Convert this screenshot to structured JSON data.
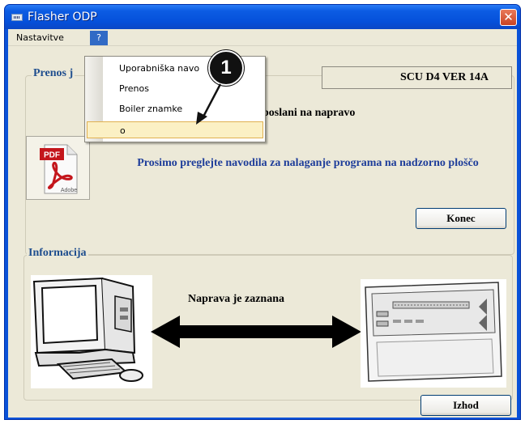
{
  "window": {
    "title": "Flasher ODP",
    "close_glyph": "✕"
  },
  "menubar": {
    "items": [
      {
        "label": "Nastavitve"
      },
      {
        "label": "?"
      }
    ]
  },
  "transfer_group": {
    "title": "Prenos j",
    "version": "SCU D4 VER  14A",
    "status": "poslani na napravo",
    "message": "Prosimo preglejte navodila za nalaganje programa na nadzorno ploščo",
    "end_button": "Konec",
    "pdf_label": "PDF",
    "pdf_brand": "Adobe"
  },
  "info_group": {
    "title": "Informacija",
    "detected": "Naprava je zaznana"
  },
  "exit_button": "Izhod",
  "dropdown": {
    "items": [
      {
        "label": "Uporabniška navo"
      },
      {
        "label": "Prenos"
      },
      {
        "label": "Boiler znamke"
      },
      {
        "label": "o"
      }
    ],
    "highlighted_index": 3
  },
  "callout": {
    "number": "1"
  },
  "colors": {
    "titlebar": "#0550da",
    "client_bg": "#ece9d8",
    "group_title": "#1e4d8e",
    "message_text": "#1e3d9a",
    "highlight_bg": "#fbf0c4",
    "close_button": "#c94424"
  }
}
